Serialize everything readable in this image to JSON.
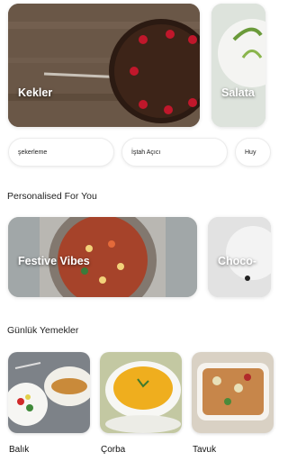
{
  "categories": [
    {
      "label": "Kekler"
    },
    {
      "label": "Salata"
    }
  ],
  "chips": [
    "şekerleme",
    "İştah Açıcı",
    "Huy"
  ],
  "personalised": {
    "title": "Personalised For You",
    "cards": [
      {
        "label": "Festive Vibes"
      },
      {
        "label": "Choco-"
      }
    ]
  },
  "daily": {
    "title": "Günlük Yemekler",
    "items": [
      {
        "label": "Balık"
      },
      {
        "label": "Çorba"
      },
      {
        "label": "Tavuk"
      }
    ]
  }
}
